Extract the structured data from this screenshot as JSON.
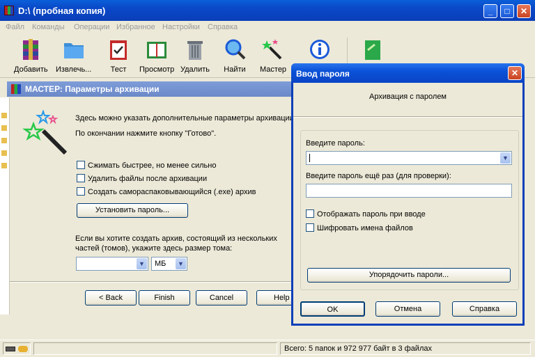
{
  "main_window": {
    "title": "D:\\ (пробная копия)"
  },
  "menu": [
    "Файл",
    "Команды",
    "Операции",
    "Избранное",
    "Настройки",
    "Справка"
  ],
  "toolbar": [
    "Добавить",
    "Извлечь...",
    "Тест",
    "Просмотр",
    "Удалить",
    "Найти",
    "Мастер"
  ],
  "wizard": {
    "title": "МАСТЕР:  Параметры архивации",
    "intro": "Здесь можно указать дополнительные параметры архивации",
    "finish_hint": "По окончании нажмите кнопку \"Готово\".",
    "options": [
      "Сжимать быстрее, но менее сильно",
      "Удалить файлы после архивации",
      "Создать самораспаковывающийся (.exe) архив"
    ],
    "set_password": "Установить пароль...",
    "volume_text_1": "Если вы хотите создать архив, состоящий из нескольких",
    "volume_text_2": "частей (томов), укажите здесь размер тома:",
    "volume_value": "",
    "unit": "МБ",
    "back": "< Back",
    "finish": "Finish",
    "cancel": "Cancel",
    "help": "Help"
  },
  "password_dialog": {
    "title": "Ввод пароля",
    "heading": "Архивация с паролем",
    "enter_label": "Введите пароль:",
    "password_value": "",
    "reenter_label": "Введите пароль ещё раз (для проверки):",
    "reenter_value": "",
    "show_password": "Отображать пароль при вводе",
    "encrypt_names": "Шифровать имена файлов",
    "organize": "Упорядочить пароли...",
    "ok": "OK",
    "cancel": "Отмена",
    "help": "Справка"
  },
  "status": {
    "text": "Всего: 5 папок и 972 977 байт в 3 файлах"
  },
  "colors": {
    "title_active": "#0a48c8",
    "title_inactive": "#7e9cd8",
    "face": "#ece9d8",
    "close": "#c94422"
  }
}
